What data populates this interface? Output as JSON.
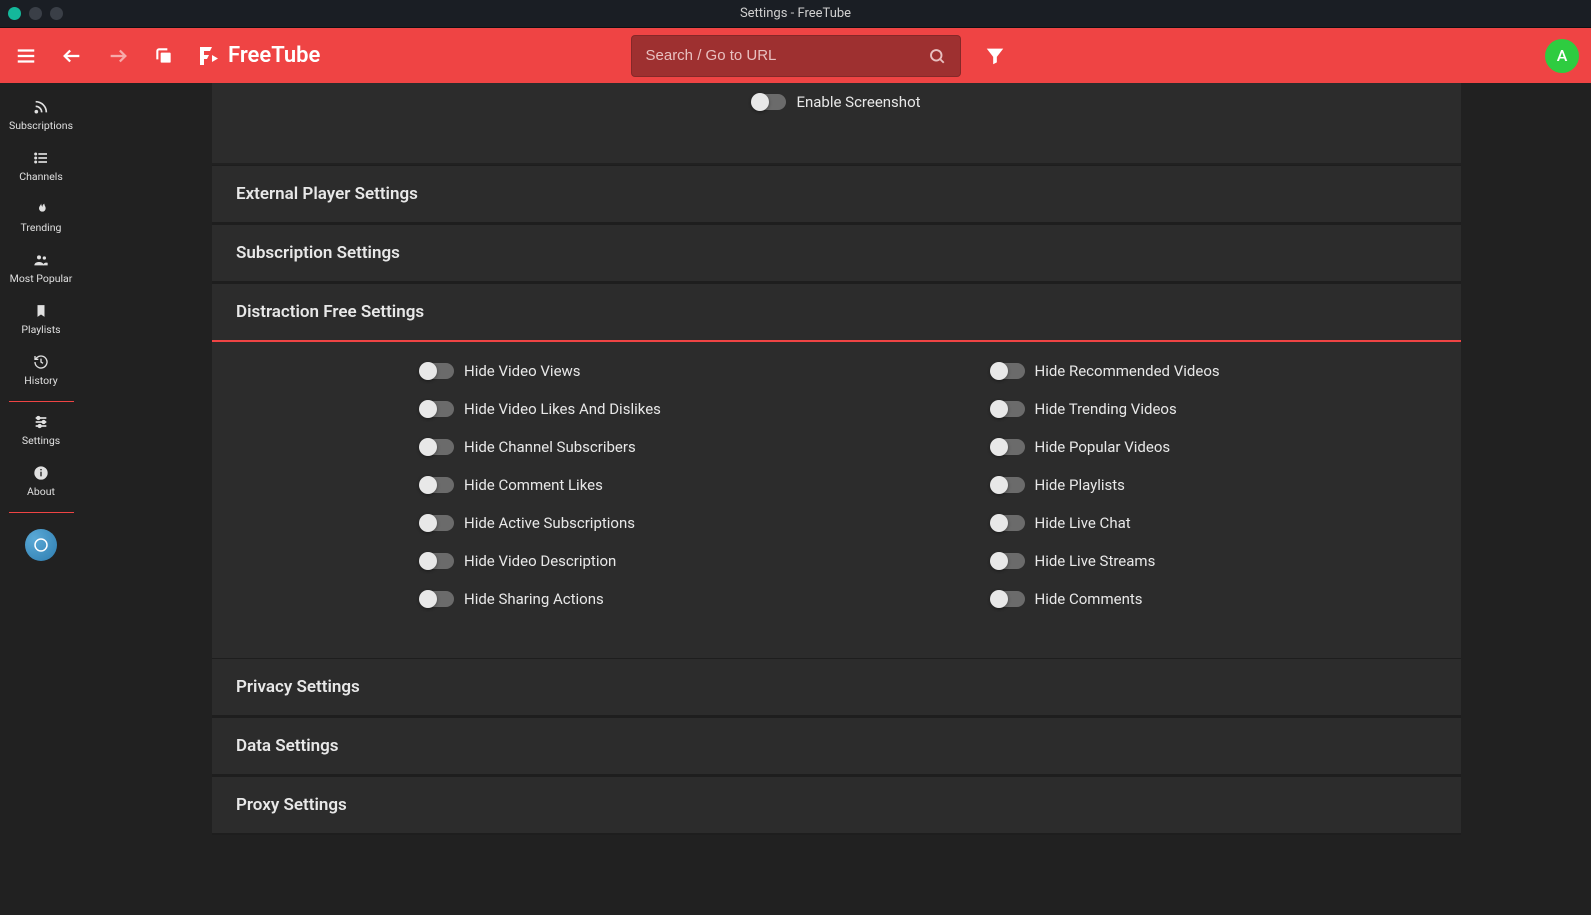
{
  "window": {
    "title": "Settings - FreeTube"
  },
  "topbar": {
    "logo_text": "FreeTube",
    "search_placeholder": "Search / Go to URL",
    "avatar_initial": "A"
  },
  "sidebar": {
    "items": [
      {
        "label": "Subscriptions"
      },
      {
        "label": "Channels"
      },
      {
        "label": "Trending"
      },
      {
        "label": "Most Popular"
      },
      {
        "label": "Playlists"
      },
      {
        "label": "History"
      }
    ],
    "bottom_items": [
      {
        "label": "Settings"
      },
      {
        "label": "About"
      }
    ]
  },
  "screenshot": {
    "enable_label": "Enable Screenshot"
  },
  "sections": {
    "external_player": "External Player Settings",
    "subscription": "Subscription Settings",
    "distraction_free": "Distraction Free Settings",
    "privacy": "Privacy Settings",
    "data": "Data Settings",
    "proxy": "Proxy Settings"
  },
  "distraction_toggles_left": [
    {
      "label": "Hide Video Views"
    },
    {
      "label": "Hide Video Likes And Dislikes"
    },
    {
      "label": "Hide Channel Subscribers"
    },
    {
      "label": "Hide Comment Likes"
    },
    {
      "label": "Hide Active Subscriptions"
    },
    {
      "label": "Hide Video Description"
    },
    {
      "label": "Hide Sharing Actions"
    }
  ],
  "distraction_toggles_right": [
    {
      "label": "Hide Recommended Videos"
    },
    {
      "label": "Hide Trending Videos"
    },
    {
      "label": "Hide Popular Videos"
    },
    {
      "label": "Hide Playlists"
    },
    {
      "label": "Hide Live Chat"
    },
    {
      "label": "Hide Live Streams"
    },
    {
      "label": "Hide Comments"
    }
  ]
}
